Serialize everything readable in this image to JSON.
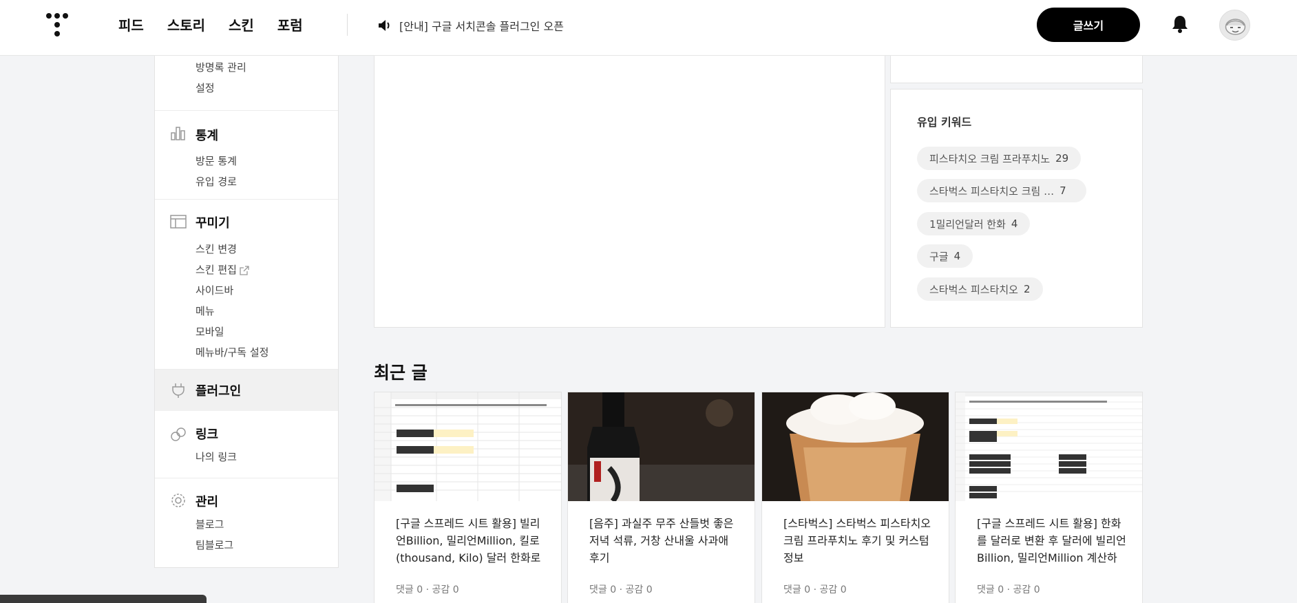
{
  "header": {
    "nav": [
      "피드",
      "스토리",
      "스킨",
      "포럼"
    ],
    "notice": "[안내] 구글 서치콘솔 플러그인 오픈",
    "write_label": "글쓰기"
  },
  "sidebar": {
    "top_items": [
      "방명록 관리",
      "설정"
    ],
    "stats": {
      "title": "통계",
      "items": [
        "방문 통계",
        "유입 경로"
      ]
    },
    "decorate": {
      "title": "꾸미기",
      "items": [
        "스킨 변경",
        "스킨 편집",
        "사이드바",
        "메뉴",
        "모바일",
        "메뉴바/구독 설정"
      ]
    },
    "plugin": {
      "title": "플러그인"
    },
    "link": {
      "title": "링크",
      "items": [
        "나의 링크"
      ]
    },
    "manage": {
      "title": "관리",
      "items": [
        "블로그",
        "팀블로그"
      ]
    }
  },
  "keywords": {
    "title": "유입 키워드",
    "items": [
      {
        "label": "피스타치오 크림 프라푸치노",
        "count": "29"
      },
      {
        "label": "스타벅스 피스타치오 크림 …",
        "count": "7"
      },
      {
        "label": "1밀리언달러 한화",
        "count": "4"
      },
      {
        "label": "구글",
        "count": "4"
      },
      {
        "label": "스타벅스 피스타치오",
        "count": "2"
      }
    ]
  },
  "recent": {
    "title": "최근 글",
    "cards": [
      {
        "title": "[구글 스프레드 시트 활용] 빌리언Billion, 밀리언Million, 킬로(thousand, Kilo) 달러 한화로 계산하기",
        "comments": "댓글 0",
        "likes": "공감 0"
      },
      {
        "title": "[음주] 과실주 무주 산들벗 좋은저녁 석류, 거창 산내울 사과애 후기",
        "comments": "댓글 0",
        "likes": "공감 0"
      },
      {
        "title": "[스타벅스] 스타벅스 피스타치오 크림 프라푸치노 후기 및 커스텀 정보",
        "comments": "댓글 0",
        "likes": "공감 0"
      },
      {
        "title": "[구글 스프레드 시트 활용] 한화를 달러로 변환 후 달러에 빌리언Billion, 밀리언Million 계산하기",
        "comments": "댓글 0",
        "likes": "공감 0"
      }
    ]
  }
}
